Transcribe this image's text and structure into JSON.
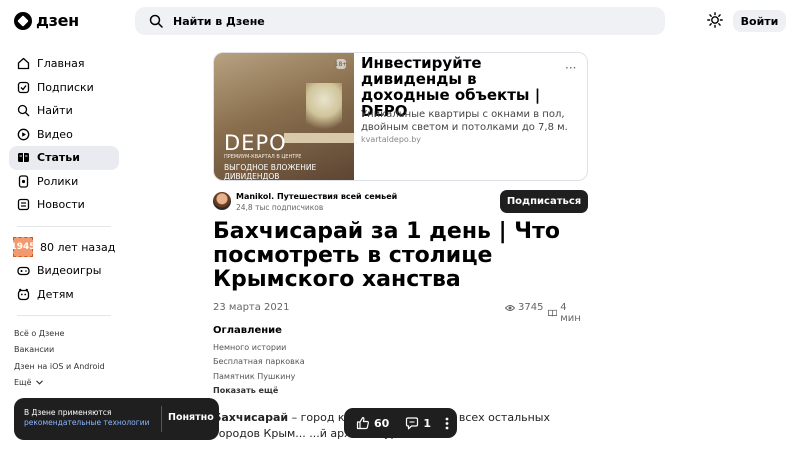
{
  "header": {
    "logo": "дзен",
    "search_placeholder": "Найти в Дзене",
    "login_label": "Войти"
  },
  "sidebar": {
    "items": [
      {
        "label": "Главная",
        "icon": "home-icon"
      },
      {
        "label": "Подписки",
        "icon": "subscriptions-icon"
      },
      {
        "label": "Найти",
        "icon": "search-icon"
      },
      {
        "label": "Видео",
        "icon": "video-icon"
      },
      {
        "label": "Статьи",
        "icon": "articles-icon",
        "active": true
      },
      {
        "label": "Ролики",
        "icon": "shorts-icon"
      },
      {
        "label": "Новости",
        "icon": "news-icon"
      }
    ],
    "extra": [
      {
        "label": "80 лет назад",
        "icon": "anniversary-stamp-icon",
        "badge": "1945"
      },
      {
        "label": "Видеоигры",
        "icon": "gamepad-icon"
      },
      {
        "label": "Детям",
        "icon": "kids-icon"
      }
    ],
    "footer": [
      "Всё о Дзене",
      "Вакансии",
      "Дзен на iOS и Android",
      "Ещё"
    ]
  },
  "ad": {
    "title": "Инвестируйте дивиденды в доходные объекты | DEPO",
    "description": "Уникальные квартиры с окнами в пол, двойным светом и потолками до 7,8 м.",
    "link": "kvartaldepo.by",
    "image_brand": "DEPO",
    "image_subtext": "ПРЕМИУМ-КВАРТАЛ В ЦЕНТРЕ",
    "image_tagline": "ВЫГОДНОЕ ВЛОЖЕНИЕ ДИВИДЕНДОВ",
    "badge": "18+"
  },
  "author": {
    "name": "Manikol. Путешествия всей семьей",
    "subscribers": "24,8 тыс подписчиков",
    "subscribe_label": "Подписаться"
  },
  "article": {
    "title": "Бахчисарай за 1 день | Что посмотреть в столице Крымского ханства",
    "date": "23 марта 2021",
    "views": "3745",
    "read_time": "4 мин",
    "toc_title": "Оглавление",
    "toc": [
      "Немного истории",
      "Бесплатная парковка",
      "Памятник Пушкину"
    ],
    "toc_more": "Показать ещё",
    "body_bold": "Бахчисарай",
    "body_rest": " – город кол... отличается от всех остальных городов Крым... ...й архитектурой."
  },
  "cookie": {
    "text": "В Дзене применяются",
    "link": "рекомендательные технологии",
    "button": "Понятно"
  },
  "actions": {
    "likes": "60",
    "comments": "1"
  }
}
